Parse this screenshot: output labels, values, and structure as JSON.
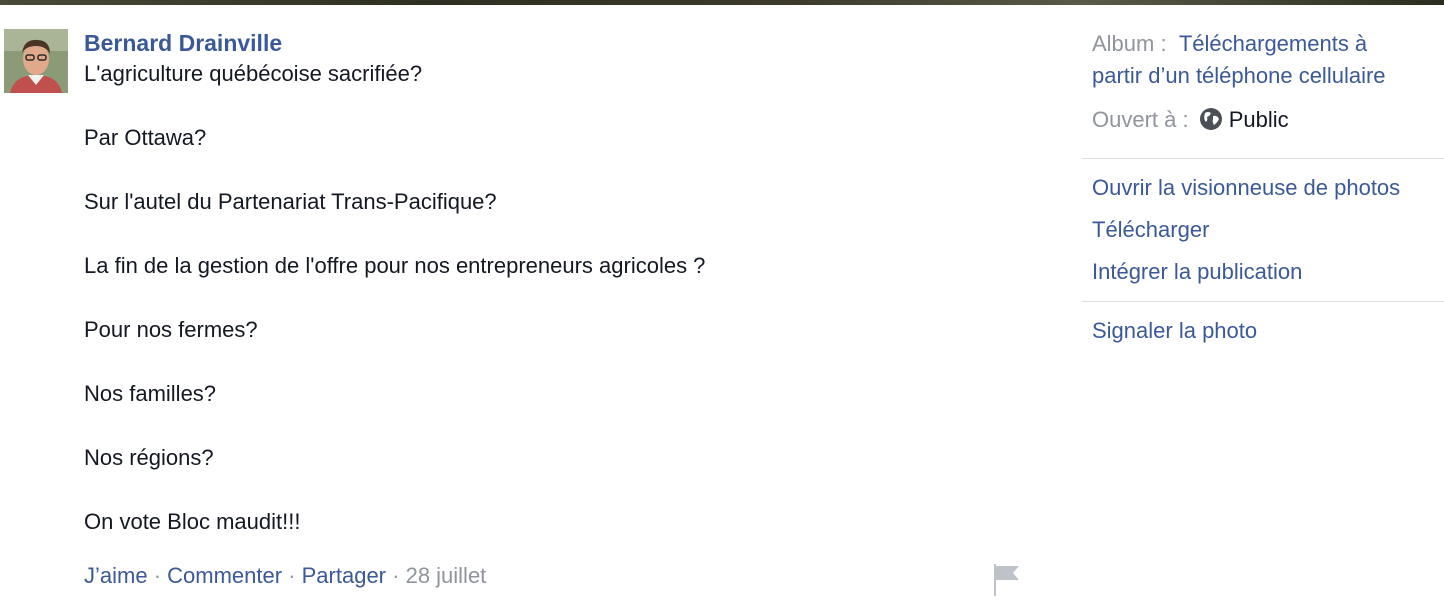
{
  "post": {
    "author": "Bernard Drainville",
    "paragraphs": [
      "L'agriculture québécoise sacrifiée?",
      "Par Ottawa?",
      "Sur l'autel du Partenariat Trans-Pacifique?",
      "La fin de la gestion de l'offre pour nos entrepreneurs agricoles ?",
      "Pour nos fermes?",
      "Nos familles?",
      "Nos régions?",
      "On vote Bloc maudit!!!"
    ],
    "actions": {
      "like": "J’aime",
      "comment": "Commenter",
      "share": "Partager",
      "separator": " · ",
      "date": "28 juillet"
    }
  },
  "sidebar": {
    "album_label": "Album :",
    "album_name_line1": "Téléchargements à",
    "album_name_line2": "partir d’un téléphone cellulaire",
    "audience_label": "Ouvert à :",
    "audience_value": "Public",
    "links": {
      "open_viewer": "Ouvrir la visionneuse de photos",
      "download": "Télécharger",
      "embed": "Intégrer la publication",
      "report": "Signaler la photo"
    }
  },
  "icons": {
    "avatar": "profile-photo",
    "audience": "globe-icon",
    "report_flag": "flag-icon"
  },
  "colors": {
    "link": "#3b5998",
    "muted": "#90949c",
    "text": "#141823",
    "divider": "#dddfe2"
  }
}
